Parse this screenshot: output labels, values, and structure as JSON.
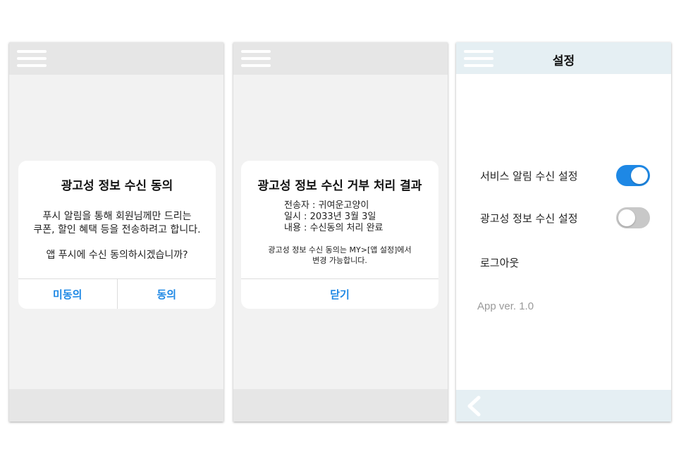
{
  "screen1": {
    "dialog": {
      "title": "광고성 정보 수신 동의",
      "body_line1": "푸시 알림을 통해 회원님께만 드리는",
      "body_line2": "쿠폰, 할인 혜택 등을 전송하려고 합니다.",
      "body_line3": "앱 푸시에 수신 동의하시겠습니까?",
      "disagree_label": "미동의",
      "agree_label": "동의"
    }
  },
  "screen2": {
    "dialog": {
      "title": "광고성 정보 수신 거부 처리 결과",
      "sender": "전송자 : 귀여운고양이",
      "date": "일시 : 2033년 3월 3일",
      "content": "내용 : 수신동의 처리 완료",
      "note_line1": "광고성 정보 수신 동의는 MY>[앱 설정]에서",
      "note_line2": "변경 가능합니다.",
      "close_label": "닫기"
    }
  },
  "screen3": {
    "title": "설정",
    "service_alert_label": "서비스 알림 수신 설정",
    "service_alert_on": true,
    "ad_info_label": "광고성 정보 수신 설정",
    "ad_info_on": false,
    "logout_label": "로그아웃",
    "version": "App ver. 1.0"
  },
  "colors": {
    "accent": "#1e88e5",
    "toggle_off": "#c8c8c8",
    "bar_gray": "#e6e6e6",
    "bar_light_blue": "#e5eff3",
    "background_gray": "#f2f2f2"
  },
  "icons": {
    "menu": "hamburger-menu-icon",
    "back": "chevron-left-icon"
  }
}
